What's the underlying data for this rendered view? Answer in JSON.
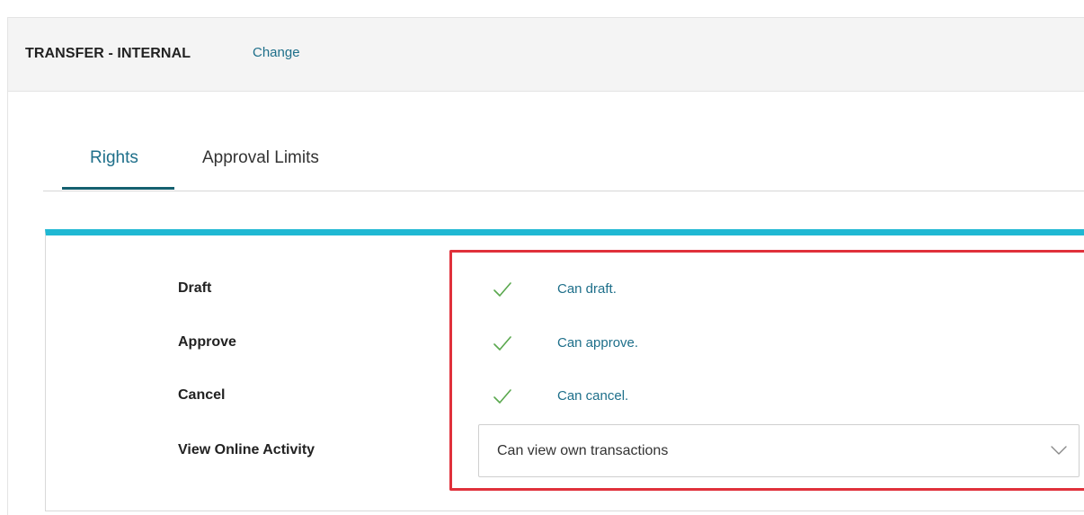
{
  "header": {
    "title": "TRANSFER - INTERNAL",
    "change_label": "Change"
  },
  "tabs": [
    {
      "label": "Rights",
      "active": true
    },
    {
      "label": "Approval Limits",
      "active": false
    }
  ],
  "rights": {
    "rows": [
      {
        "label": "Draft",
        "value": "Can draft.",
        "icon": "check-icon"
      },
      {
        "label": "Approve",
        "value": "Can approve.",
        "icon": "check-icon"
      },
      {
        "label": "Cancel",
        "value": "Can cancel.",
        "icon": "check-icon"
      }
    ],
    "view_online_activity": {
      "label": "View Online Activity",
      "selected": "Can view own transactions",
      "icon": "chevron-down-icon"
    }
  },
  "colors": {
    "accent": "#1fb8d3",
    "link": "#1e6f8a",
    "tab_underline": "#14606f",
    "check": "#5aa84e",
    "highlight": "#e0313b"
  }
}
